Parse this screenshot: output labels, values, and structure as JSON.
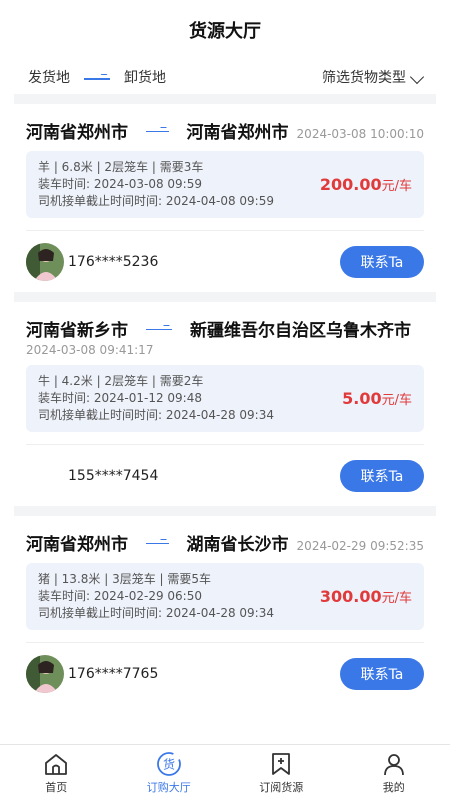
{
  "header": {
    "title": "货源大厅"
  },
  "filter": {
    "from_label": "发货地",
    "to_label": "卸货地",
    "type_label": "筛选货物类型"
  },
  "cards": [
    {
      "from": "河南省郑州市",
      "to": "河南省郑州市",
      "posted_time": "2024-03-08 10:00:10",
      "cargo": "羊 | 6.8米 | 2层笼车 | 需要3车",
      "load_time": "装车时间:   2024-03-08 09:59",
      "deadline": "司机接单截止时间时间:   2024-04-08 09:59",
      "price": "200.00",
      "price_unit": "元/车",
      "phone": "176****5236",
      "contact_label": "联系Ta"
    },
    {
      "from": "河南省新乡市",
      "to": "新疆维吾尔自治区乌鲁木齐市",
      "posted_time": "2024-03-08 09:41:17",
      "cargo": "牛 | 4.2米 | 2层笼车 | 需要2车",
      "load_time": "装车时间:   2024-01-12 09:48",
      "deadline": "司机接单截止时间时间:   2024-04-28 09:34",
      "price": "5.00",
      "price_unit": "元/车",
      "phone": "155****7454",
      "contact_label": "联系Ta"
    },
    {
      "from": "河南省郑州市",
      "to": "湖南省长沙市",
      "posted_time": "2024-02-29 09:52:35",
      "cargo": "猪 | 13.8米 | 3层笼车 | 需要5车",
      "load_time": "装车时间:   2024-02-29 06:50",
      "deadline": "司机接单截止时间时间:   2024-04-28 09:34",
      "price": "300.00",
      "price_unit": "元/车",
      "phone": "176****7765",
      "contact_label": "联系Ta"
    }
  ],
  "tabbar": {
    "home": "首页",
    "hall": "订购大厅",
    "subscribe": "订阅货源",
    "mine": "我的",
    "hall_icon_char": "货"
  },
  "colors": {
    "accent": "#3b78e7",
    "price": "#e03a3a",
    "info_bg": "#eef2fb"
  }
}
